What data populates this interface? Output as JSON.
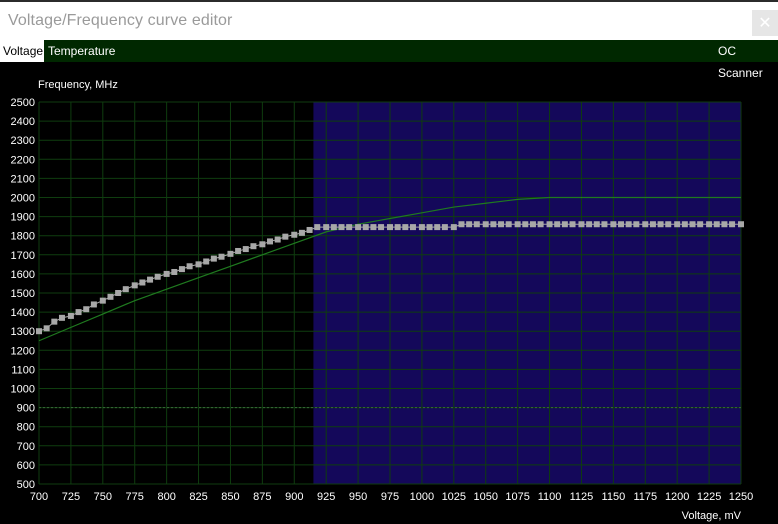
{
  "window": {
    "title": "Voltage/Frequency curve editor",
    "close_glyph": "✕"
  },
  "tabs": [
    {
      "label": "Voltage",
      "active": true
    },
    {
      "label": "Temperature",
      "active": false
    }
  ],
  "oc_scanner_label": "OC Scanner",
  "colors": {
    "background": "#000000",
    "grid": "#0f3d0f",
    "selection": "#14085a",
    "curve": "#a8a8a8",
    "reference_line": "#1f7a1f",
    "tabbar": "#002800"
  },
  "chart_data": {
    "type": "line",
    "ylabel": "Frequency, MHz",
    "xlabel": "Voltage, mV",
    "xlim": [
      700,
      1250
    ],
    "ylim": [
      500,
      2500
    ],
    "x_ticks": [
      700,
      725,
      750,
      775,
      800,
      825,
      850,
      875,
      900,
      925,
      950,
      975,
      1000,
      1025,
      1050,
      1075,
      1100,
      1125,
      1150,
      1175,
      1200,
      1225,
      1250
    ],
    "y_ticks": [
      500,
      600,
      700,
      800,
      900,
      1000,
      1100,
      1200,
      1300,
      1400,
      1500,
      1600,
      1700,
      1800,
      1900,
      2000,
      2100,
      2200,
      2300,
      2400,
      2500
    ],
    "grid": true,
    "selected_range": [
      915,
      1250
    ],
    "dashed_level": 900,
    "series": [
      {
        "role": "curve",
        "style": "points",
        "x": [
          700,
          706,
          712,
          718,
          725,
          731,
          737,
          743,
          750,
          756,
          762,
          768,
          775,
          781,
          787,
          793,
          800,
          806,
          812,
          818,
          825,
          831,
          837,
          843,
          850,
          856,
          862,
          868,
          875,
          881,
          887,
          893,
          900,
          906,
          912,
          918,
          925,
          931,
          937,
          943,
          950,
          956,
          962,
          968,
          975,
          981,
          987,
          993,
          1000,
          1006,
          1012,
          1018,
          1025,
          1031,
          1037,
          1043,
          1050,
          1056,
          1062,
          1068,
          1075,
          1081,
          1087,
          1093,
          1100,
          1106,
          1112,
          1118,
          1125,
          1131,
          1137,
          1143,
          1150,
          1156,
          1162,
          1168,
          1175,
          1181,
          1187,
          1193,
          1200,
          1206,
          1212,
          1218,
          1225,
          1231,
          1237,
          1243,
          1250
        ],
        "y": [
          1300,
          1315,
          1350,
          1370,
          1380,
          1400,
          1415,
          1440,
          1460,
          1480,
          1500,
          1520,
          1540,
          1555,
          1570,
          1585,
          1600,
          1610,
          1625,
          1640,
          1650,
          1665,
          1680,
          1690,
          1705,
          1720,
          1730,
          1745,
          1755,
          1770,
          1780,
          1795,
          1805,
          1815,
          1830,
          1845,
          1845,
          1845,
          1845,
          1845,
          1845,
          1845,
          1845,
          1845,
          1845,
          1845,
          1845,
          1845,
          1845,
          1845,
          1845,
          1845,
          1845,
          1860,
          1860,
          1860,
          1860,
          1860,
          1860,
          1860,
          1860,
          1860,
          1860,
          1860,
          1860,
          1860,
          1860,
          1860,
          1860,
          1860,
          1860,
          1860,
          1860,
          1860,
          1860,
          1860,
          1860,
          1860,
          1860,
          1860,
          1860,
          1860,
          1860,
          1860,
          1860,
          1860,
          1860,
          1860,
          1860
        ]
      },
      {
        "role": "reference",
        "style": "line",
        "x": [
          700,
          725,
          750,
          775,
          800,
          825,
          850,
          875,
          900,
          925,
          950,
          975,
          1000,
          1025,
          1050,
          1075,
          1100,
          1125,
          1150,
          1175,
          1200,
          1225,
          1250
        ],
        "y": [
          1250,
          1320,
          1390,
          1460,
          1520,
          1580,
          1640,
          1700,
          1760,
          1820,
          1860,
          1890,
          1920,
          1950,
          1970,
          1990,
          2000,
          2000,
          2000,
          2000,
          2000,
          2000,
          2000
        ]
      }
    ]
  }
}
